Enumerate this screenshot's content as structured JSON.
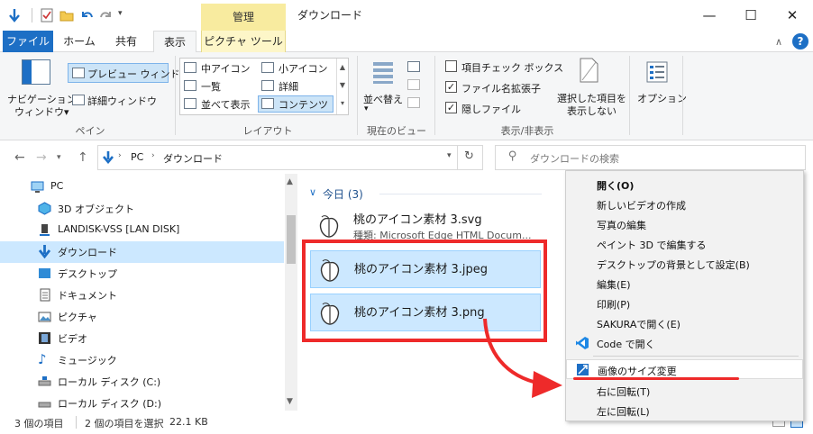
{
  "window": {
    "title": "ダウンロード",
    "context_tab_group": "管理",
    "controls": [
      "—",
      "☐",
      "✕"
    ]
  },
  "ribbon_tabs": [
    "ファイル",
    "ホーム",
    "共有",
    "表示",
    "ピクチャ ツール"
  ],
  "ribbon": {
    "pane": {
      "nav_pane_line1": "ナビゲーション",
      "nav_pane_line2": "ウィンドウ▾",
      "preview_pane": "プレビュー ウィンドウ",
      "details_pane": "詳細ウィンドウ",
      "group_label": "ペイン"
    },
    "layout": {
      "items": [
        "中アイコン",
        "小アイコン",
        "一覧",
        "詳細",
        "並べて表示",
        "コンテンツ"
      ],
      "group_label": "レイアウト"
    },
    "current_view": {
      "sort_label": "並べ替え",
      "group_label": "現在のビュー"
    },
    "show_hide": {
      "item_checkboxes": "項目チェック ボックス",
      "file_extensions": "ファイル名拡張子",
      "hidden_items": "隠しファイル",
      "hide_selected_line1": "選択した項目を",
      "hide_selected_line2": "表示しない",
      "group_label": "表示/非表示",
      "item_checkboxes_checked": false,
      "file_extensions_checked": true,
      "hidden_items_checked": true
    },
    "options_label": "オプション"
  },
  "address": {
    "path": [
      "PC",
      "ダウンロード"
    ],
    "search_placeholder": "ダウンロードの検索"
  },
  "nav_pane": {
    "items": [
      "PC",
      "3D オブジェクト",
      "LANDISK-VSS [LAN DISK]",
      "ダウンロード",
      "デスクトップ",
      "ドキュメント",
      "ピクチャ",
      "ビデオ",
      "ミュージック",
      "ローカル ディスク (C:)",
      "ローカル ディスク (D:)"
    ]
  },
  "content": {
    "group_header": "今日 (3)",
    "files": [
      {
        "name": "桃のアイコン素材 3.svg",
        "type_label": "種類: Microsoft Edge HTML Docum..."
      },
      {
        "name": "桃のアイコン素材 3.jpeg"
      },
      {
        "name": "桃のアイコン素材 3.png"
      }
    ]
  },
  "status": {
    "item_count": "3 個の項目",
    "selection": "2 個の項目を選択",
    "size": "22.1 KB"
  },
  "context_menu": {
    "items": [
      "開く(O)",
      "新しいビデオの作成",
      "写真の編集",
      "ペイント 3D で編集する",
      "デスクトップの背景として設定(B)",
      "編集(E)",
      "印刷(P)",
      "SAKURAで開く(E)",
      "Code で開く",
      "画像のサイズ変更",
      "右に回転(T)",
      "左に回転(L)"
    ]
  },
  "colors": {
    "accent": "#1d6fc5",
    "selection": "#cce8ff",
    "annotation_red": "#ee2a2a",
    "context_tab": "#f8eb9f"
  }
}
